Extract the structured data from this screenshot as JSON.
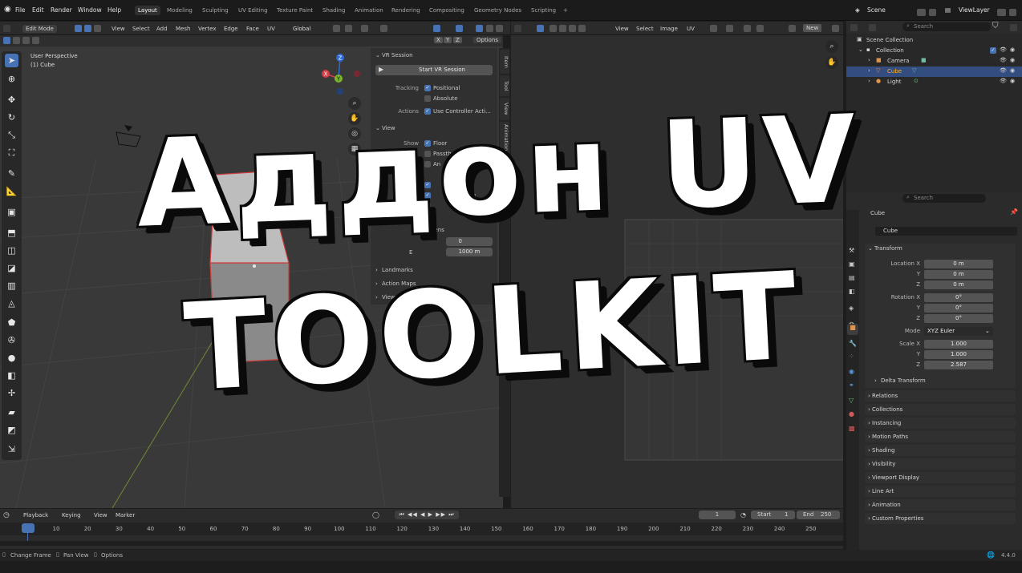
{
  "menus": [
    "File",
    "Edit",
    "Render",
    "Window",
    "Help"
  ],
  "workspaces": [
    "Layout",
    "Modeling",
    "Sculpting",
    "UV Editing",
    "Texture Paint",
    "Shading",
    "Animation",
    "Rendering",
    "Compositing",
    "Geometry Nodes",
    "Scripting",
    "+"
  ],
  "scene": {
    "name": "Scene",
    "view_layer": "ViewLayer"
  },
  "view3d": {
    "mode": "Edit Mode",
    "menu": [
      "View",
      "Select",
      "Add",
      "Mesh",
      "Vertex",
      "Edge",
      "Face",
      "UV"
    ],
    "transform": "Global",
    "xyz": [
      "X",
      "Y",
      "Z"
    ],
    "options": "Options",
    "overlay_title": "User Perspective",
    "overlay_obj": "(1) Cube",
    "gizmo": {
      "x": "X",
      "y": "Y",
      "z": "Z"
    }
  },
  "npanel": {
    "vr_header": "VR Session",
    "start_button": "Start VR Session",
    "tracking_label": "Tracking",
    "positional": "Positional",
    "absolute": "Absolute",
    "actions_label": "Actions",
    "use_controller": "Use Controller Acti...",
    "view_header": "View",
    "show_label": "Show",
    "floor": "Floor",
    "passthrough": "Passthro",
    "annotations": "An",
    "overlays": "verlays",
    "extras": "tras",
    "dens": "Dens",
    "val_zero": "0",
    "clip_end_short": "E",
    "clip_end": "1000 m",
    "landmarks": "Landmarks",
    "action_maps": "Action Maps",
    "viewport_feedback": "Viewport Fe",
    "tabs": [
      "Item",
      "Tool",
      "View",
      "Animation",
      "VR"
    ]
  },
  "uv": {
    "menu": [
      "View",
      "Select",
      "Image",
      "UV"
    ],
    "new_button": "New"
  },
  "outliner": {
    "search_placeholder": "Search",
    "rows": [
      {
        "label": "Scene Collection"
      },
      {
        "label": "Collection"
      },
      {
        "label": "Camera"
      },
      {
        "label": "Cube"
      },
      {
        "label": "Light"
      }
    ]
  },
  "properties": {
    "search_placeholder": "Search",
    "object": "Cube",
    "object_field": "Cube",
    "transform": "Transform",
    "location_x_label": "Location X",
    "location_y_label": "Y",
    "location_z_label": "Z",
    "location": [
      "0 m",
      "0 m",
      "0 m"
    ],
    "rotation_x_label": "Rotation X",
    "rotation_y_label": "Y",
    "rotation_z_label": "Z",
    "rotation": [
      "0°",
      "0°",
      "0°"
    ],
    "mode_label": "Mode",
    "mode": "XYZ Euler",
    "scale_x_label": "Scale X",
    "scale_y_label": "Y",
    "scale_z_label": "Z",
    "scale": [
      "1.000",
      "1.000",
      "2.587"
    ],
    "delta": "Delta Transform",
    "sections": [
      "Relations",
      "Collections",
      "Instancing",
      "Motion Paths",
      "Shading",
      "Visibility",
      "Viewport Display",
      "Line Art",
      "Animation",
      "Custom Properties"
    ]
  },
  "timeline": {
    "menu": [
      "Playback",
      "Keying",
      "View",
      "Marker"
    ],
    "current_frame": "1",
    "start_label": "Start",
    "start": "1",
    "end_label": "End",
    "end": "250",
    "ticks": [
      "1",
      "10",
      "20",
      "30",
      "40",
      "50",
      "60",
      "70",
      "80",
      "90",
      "100",
      "110",
      "120",
      "130",
      "140",
      "150",
      "160",
      "170",
      "180",
      "190",
      "200",
      "210",
      "220",
      "230",
      "240",
      "250"
    ]
  },
  "statusbar": {
    "change_frame": "Change Frame",
    "pan_view": "Pan View",
    "options": "Options",
    "version": "4.4.0"
  },
  "overlay_title": {
    "line1": "Аддон UV",
    "line2": "TOOLKIT"
  },
  "colors": {
    "accent": "#4772b3",
    "bg": "#393939",
    "header": "#2b2b2b",
    "selected_row": "#334d80"
  }
}
